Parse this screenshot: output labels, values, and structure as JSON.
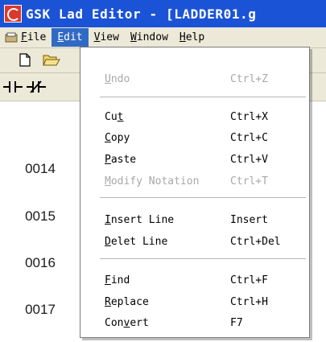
{
  "window": {
    "title": "GSK Lad Editor - [LADDER01.g"
  },
  "menubar": [
    {
      "key": "F",
      "rest": "ile"
    },
    {
      "key": "E",
      "rest": "dit"
    },
    {
      "key": "V",
      "rest": "iew"
    },
    {
      "key": "W",
      "rest": "indow"
    },
    {
      "key": "H",
      "rest": "elp"
    }
  ],
  "ladder": {
    "rows": [
      "0014",
      "0015",
      "0016",
      "0017"
    ]
  },
  "edit_menu": [
    {
      "pre": "",
      "key": "U",
      "rest": "ndo",
      "shortcut": "Ctrl+Z",
      "enabled": false
    },
    {
      "pre": "Cu",
      "key": "t",
      "rest": "",
      "shortcut": "Ctrl+X",
      "enabled": true
    },
    {
      "pre": "",
      "key": "C",
      "rest": "opy",
      "shortcut": "Ctrl+C",
      "enabled": true
    },
    {
      "pre": "",
      "key": "P",
      "rest": "aste",
      "shortcut": "Ctrl+V",
      "enabled": true
    },
    {
      "pre": "",
      "key": "M",
      "rest": "odify Notation",
      "shortcut": "Ctrl+T",
      "enabled": false
    },
    {
      "pre": "",
      "key": "I",
      "rest": "nsert Line",
      "shortcut": "Insert",
      "enabled": true
    },
    {
      "pre": "",
      "key": "D",
      "rest": "elet Line",
      "shortcut": "Ctrl+Del",
      "enabled": true
    },
    {
      "pre": "",
      "key": "F",
      "rest": "ind",
      "shortcut": "Ctrl+F",
      "enabled": true
    },
    {
      "pre": "",
      "key": "R",
      "rest": "eplace",
      "shortcut": "Ctrl+H",
      "enabled": true
    },
    {
      "pre": "Con",
      "key": "v",
      "rest": "ert",
      "shortcut": "F7",
      "enabled": true
    }
  ],
  "colors": {
    "titlebar": "#1b53d6",
    "menu_highlight": "#316ac5",
    "chrome": "#ece9d8",
    "disabled_text": "#a8a8a8"
  },
  "icons": [
    "app-logo-icon",
    "file-menu-icon",
    "new-file-icon",
    "open-folder-icon",
    "contact-no-icon",
    "contact-nc-icon"
  ]
}
